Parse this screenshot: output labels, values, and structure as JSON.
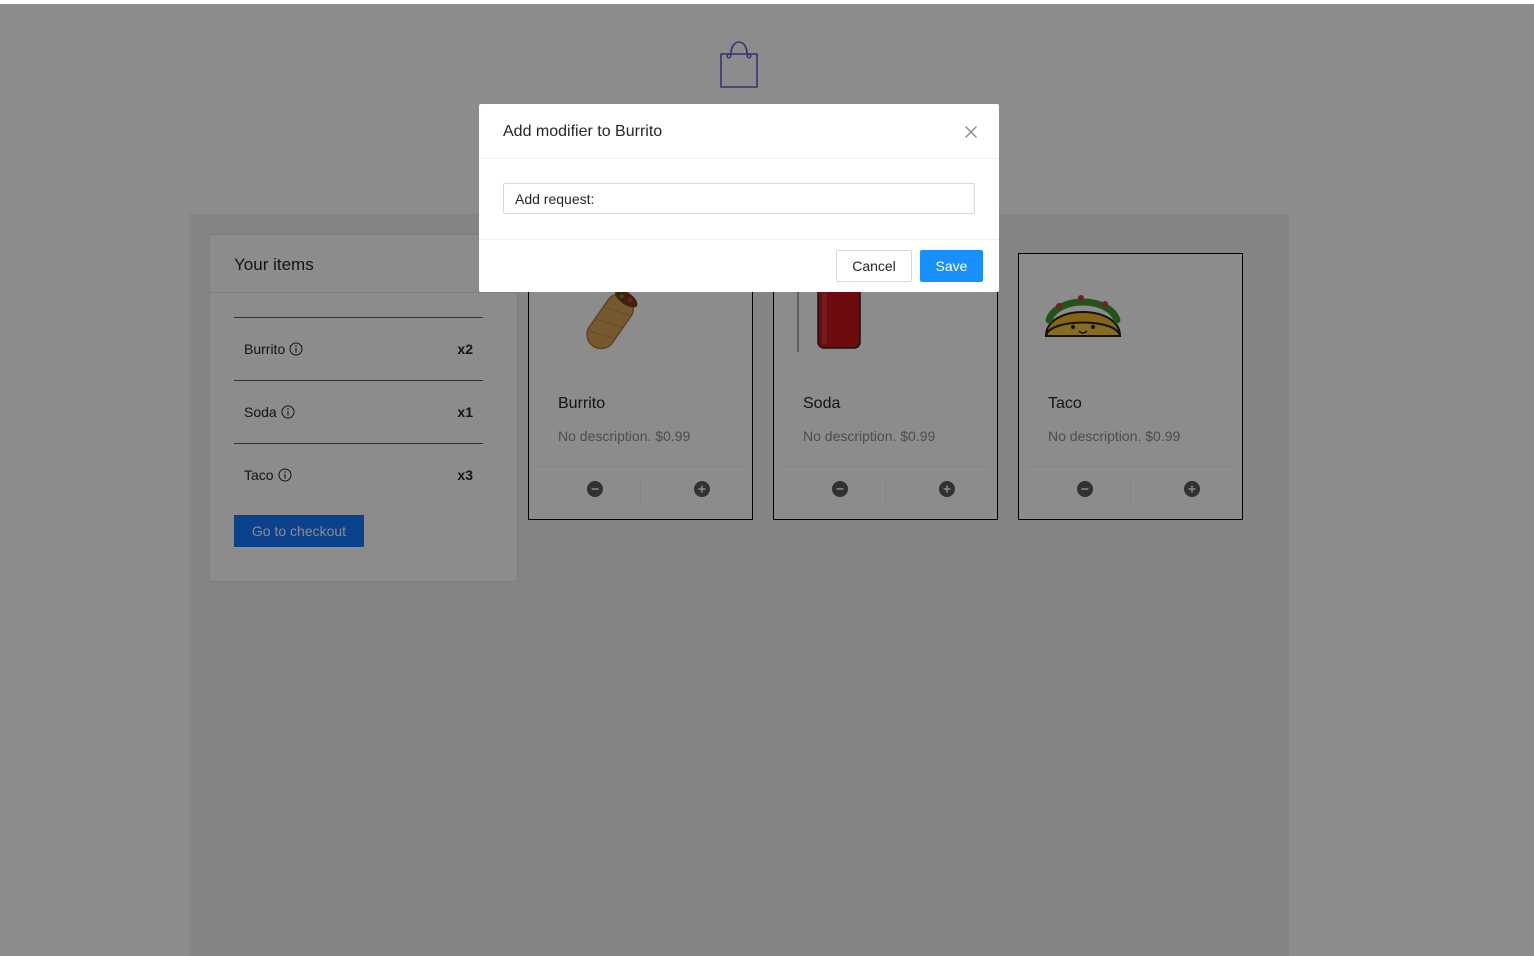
{
  "header": {
    "logo_icon": "shopping-bag-icon",
    "accent": "#5b5bd6"
  },
  "cart": {
    "title": "Your items",
    "items": [
      {
        "name": "Burrito",
        "qty": "x2"
      },
      {
        "name": "Soda",
        "qty": "x1"
      },
      {
        "name": "Taco",
        "qty": "x3"
      }
    ],
    "checkout_label": "Go to checkout"
  },
  "products": [
    {
      "title": "Burrito",
      "desc": "No description. $0.99",
      "image_icon": "burrito-icon"
    },
    {
      "title": "Soda",
      "desc": "No description. $0.99",
      "image_icon": "soda-can-icon"
    },
    {
      "title": "Taco",
      "desc": "No description. $0.99",
      "image_icon": "taco-icon"
    }
  ],
  "modal": {
    "title": "Add modifier to Burrito",
    "input_value": "Add request:",
    "cancel_label": "Cancel",
    "save_label": "Save"
  },
  "colors": {
    "primary": "#1890ff",
    "checkout": "#1677ff",
    "overlay": "rgba(0,0,0,0.45)"
  }
}
